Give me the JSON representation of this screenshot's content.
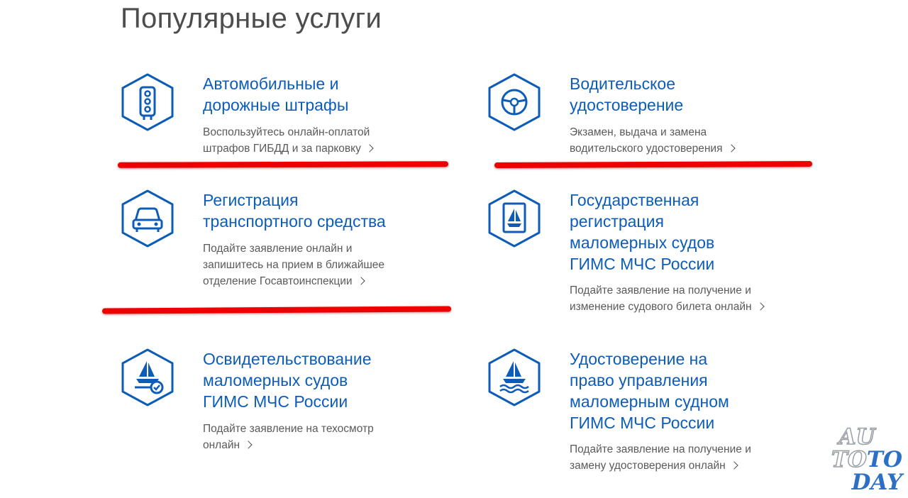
{
  "page": {
    "title": "Популярные услуги"
  },
  "colors": {
    "accent": "#0d5db8",
    "marker": "#ee0000",
    "text": "#5a5a5a"
  },
  "services": [
    {
      "icon": "traffic-light-icon",
      "title_lines": [
        "Автомобильные и",
        "дорожные штрафы"
      ],
      "desc_lines": [
        "Воспользуйтесь онлайн-оплатой",
        "штрафов ГИБДД и за парковку"
      ]
    },
    {
      "icon": "steering-wheel-icon",
      "title_lines": [
        "Водительское",
        "удостоверение"
      ],
      "desc_lines": [
        "Экзамен, выдача и замена",
        "водительского удостоверения"
      ]
    },
    {
      "icon": "car-icon",
      "title_lines": [
        "Регистрация",
        "транспортного средства"
      ],
      "desc_lines": [
        "Подайте заявление онлайн и",
        "запишитесь на прием в ближайшее",
        "отделение Госавтоинспекции"
      ]
    },
    {
      "icon": "boat-document-icon",
      "title_lines": [
        "Государственная",
        "регистрация",
        "маломерных судов",
        "ГИМС МЧС России"
      ],
      "desc_lines": [
        "Подайте заявление на получение и",
        "изменение судового билета онлайн"
      ]
    },
    {
      "icon": "boat-check-icon",
      "title_lines": [
        "Освидетельствование",
        "маломерных судов",
        "ГИМС МЧС России"
      ],
      "desc_lines": [
        "Подайте заявление на техосмотр",
        "онлайн"
      ]
    },
    {
      "icon": "boat-waves-icon",
      "title_lines": [
        "Удостоверение на",
        "право управления",
        "маломерным судном",
        "ГИМС МЧС России"
      ],
      "desc_lines": [
        "Подайте заявление на получение и",
        "замену удостоверения онлайн"
      ]
    }
  ],
  "watermark": {
    "line1": "AU",
    "line2a": "TO",
    "line2b": "TO",
    "line3": "DAY"
  }
}
